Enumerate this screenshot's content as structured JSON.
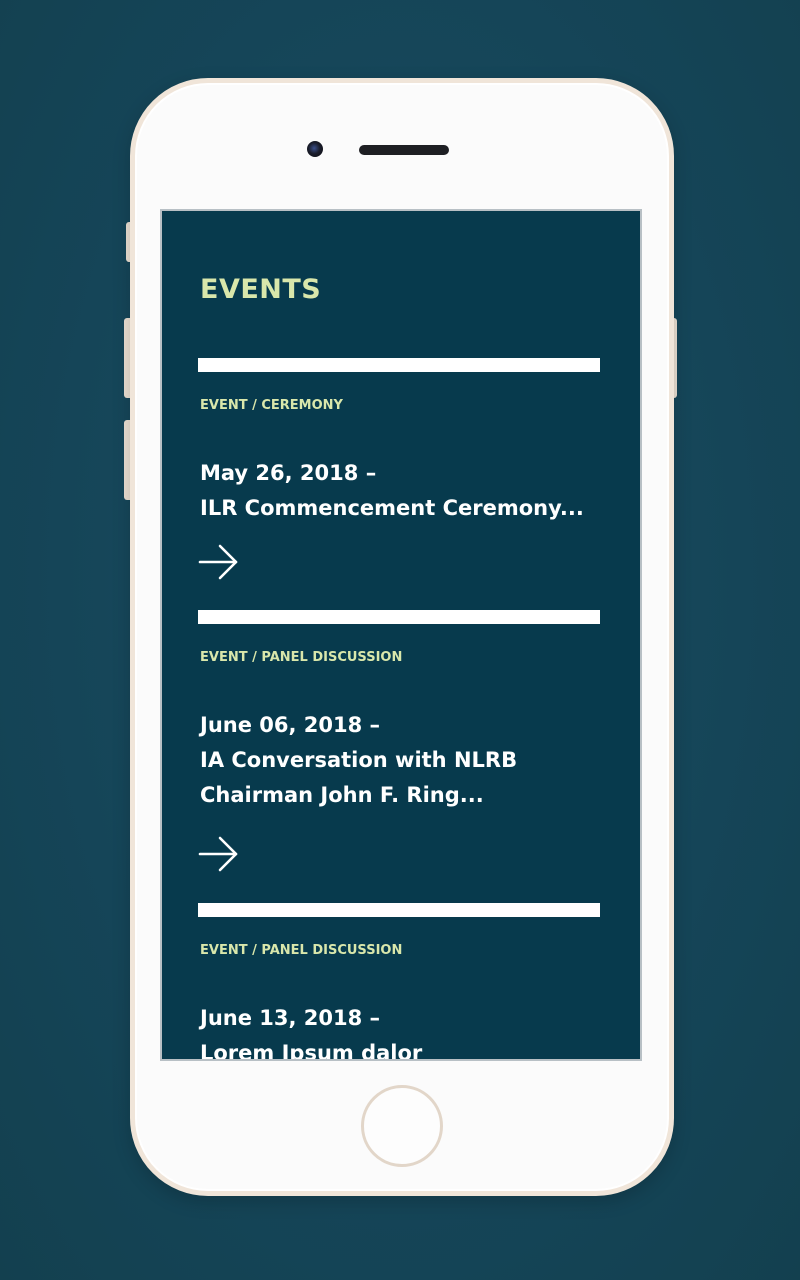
{
  "app": {
    "section_title": "EVENTS"
  },
  "events": [
    {
      "category": "EVENT / CEREMONY",
      "date": "May 26, 2018 –",
      "title_lines": [
        "ILR Commencement Ceremony..."
      ],
      "arrow_icon": "arrow-right-icon"
    },
    {
      "category": "EVENT / PANEL DISCUSSION",
      "date": "June 06, 2018 –",
      "title_lines": [
        "IA Conversation with NLRB",
        "Chairman John F. Ring..."
      ],
      "arrow_icon": "arrow-right-icon"
    },
    {
      "category": "EVENT / PANEL DISCUSSION",
      "date": "June 13, 2018 –",
      "title_lines": [
        "Lorem Ipsum dalor"
      ]
    }
  ],
  "colors": {
    "background": "#17485b",
    "screen": "#073a4d",
    "accent": "#d9e7ab",
    "text": "#ffffff",
    "phone_body": "#fbfbfb",
    "phone_trim": "#f0e5d9"
  }
}
